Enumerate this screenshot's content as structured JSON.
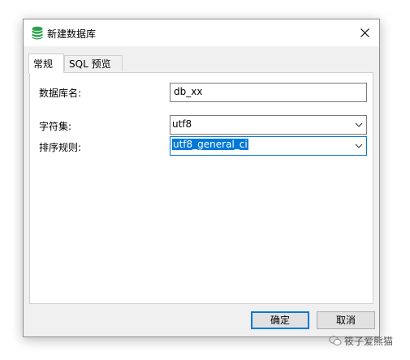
{
  "dialog": {
    "title": "新建数据库",
    "tabs": [
      {
        "label": "常规",
        "active": true
      },
      {
        "label": "SQL 预览",
        "active": false
      }
    ]
  },
  "form": {
    "db_name_label": "数据库名:",
    "db_name_value": "db_xx",
    "charset_label": "字符集:",
    "charset_value": "utf8",
    "collation_label": "排序规则:",
    "collation_value": "utf8_general_ci"
  },
  "buttons": {
    "ok": "确定",
    "cancel": "取消"
  },
  "watermark": {
    "text": "筱子爱熊猫"
  },
  "colors": {
    "accent": "#0078d7",
    "db_icon": "#2aa24b"
  },
  "icons": {
    "title": "database-icon",
    "close": "close-icon",
    "dropdown": "chevron-down-icon",
    "watermark": "wechat-icon"
  }
}
